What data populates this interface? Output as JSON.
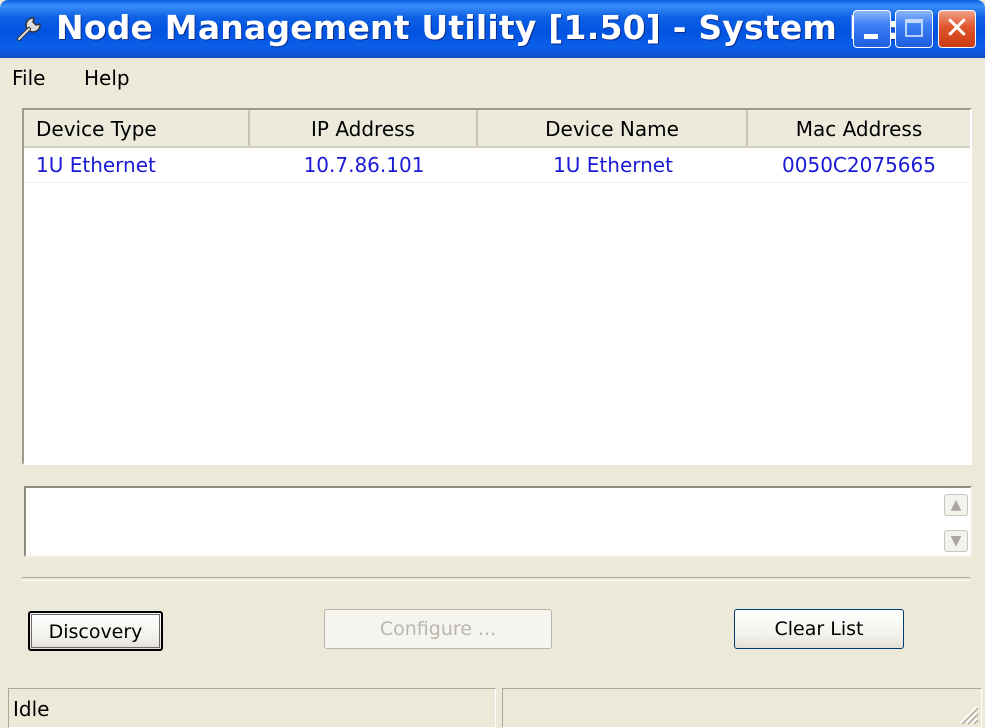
{
  "window": {
    "title": "Node Management Utility [1.50]  - System IP: ...",
    "controls": {
      "minimize": "minimize-icon",
      "maximize": "maximize-icon",
      "close": "close-icon"
    }
  },
  "menu": {
    "file": "File",
    "help": "Help"
  },
  "device_list": {
    "columns": [
      "Device Type",
      "IP Address",
      "Device Name",
      "Mac Address"
    ],
    "rows": [
      {
        "device_type": "1U Ethernet",
        "ip_address": "10.7.86.101",
        "device_name": "1U Ethernet",
        "mac_address": "0050C2075665"
      }
    ]
  },
  "log": {
    "text": ""
  },
  "buttons": {
    "discovery": "Discovery",
    "configure": "Configure ...",
    "clear_list": "Clear List"
  },
  "status": {
    "text": "Idle",
    "secondary": ""
  },
  "colors": {
    "title_bar": "#0053e0",
    "row_text": "#1a1ad6",
    "window_bg": "#ece9d8"
  }
}
